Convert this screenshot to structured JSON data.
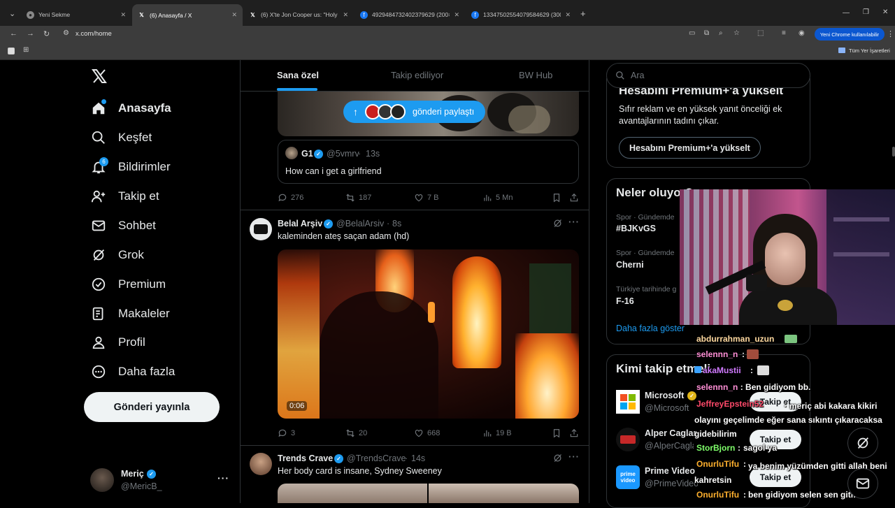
{
  "browser": {
    "tabs": [
      {
        "title": "Yeni Sekme"
      },
      {
        "title": "(6) Anasayfa / X"
      },
      {
        "title": "(6) X'te Jon Cooper us: \"Holy sh"
      },
      {
        "title": "492948473240237962​9 (200×2"
      },
      {
        "title": "133475025540795846​29 (300×"
      }
    ],
    "url": "x.com/home",
    "profile_button": "Yeni Chrome kullanılabilir",
    "bookmarks_all": "Tüm Yer İşaretleri"
  },
  "sidebar": {
    "items": [
      {
        "label": "Anasayfa",
        "icon": "home-icon"
      },
      {
        "label": "Keşfet",
        "icon": "search-icon"
      },
      {
        "label": "Bildirimler",
        "icon": "bell-icon",
        "badge": "6"
      },
      {
        "label": "Takip et",
        "icon": "person-add-icon"
      },
      {
        "label": "Sohbet",
        "icon": "mail-icon"
      },
      {
        "label": "Grok",
        "icon": "grok-icon"
      },
      {
        "label": "Premium",
        "icon": "verified-icon"
      },
      {
        "label": "Makaleler",
        "icon": "article-icon"
      },
      {
        "label": "Profil",
        "icon": "profile-icon"
      },
      {
        "label": "Daha fazla",
        "icon": "more-circle-icon"
      }
    ],
    "post_button": "Gönderi yayınla",
    "account": {
      "name": "Meriç",
      "handle": "@MericB_"
    }
  },
  "feed": {
    "tabs": [
      "Sana özel",
      "Takip ediliyor",
      "BW Hub"
    ],
    "share_pill": "gönderi paylaştı",
    "quoted": {
      "name": "G1",
      "handle": "@5vmrv",
      "time": "13s",
      "text": "How can i get a girlfriend"
    },
    "post0_metrics": {
      "replies": "276",
      "reposts": "187",
      "likes": "7 B",
      "views": "5 Mn"
    },
    "posts": [
      {
        "name": "Belal Arşiv",
        "handle": "@BelalArsiv",
        "time": "8s",
        "text": "kaleminden ateş saçan adam (hd)",
        "video_time": "0:06",
        "replies": "3",
        "reposts": "20",
        "likes": "668",
        "views": "19 B"
      },
      {
        "name": "Trends Crave",
        "handle": "@TrendsCrave",
        "time": "14s",
        "text": "Her body card is insane, Sydney Sweeney"
      }
    ]
  },
  "right": {
    "search_placeholder": "Ara",
    "premium": {
      "title": "Hesabını Premium+'a yükselt",
      "desc": "Sıfır reklam ve en yüksek yanıt önceliği ek avantajlarının tadını çıkar.",
      "button": "Hesabını Premium+'a yükselt"
    },
    "trends_title": "Neler oluyor?",
    "trends": [
      {
        "meta": "Spor · Gündemde",
        "name": "#BJKvGS"
      },
      {
        "meta": "Spor · Gündemde",
        "name": "Cherni"
      },
      {
        "meta": "Türkiye tarihinde g",
        "name": "F-16"
      }
    ],
    "show_more": "Daha fazla göster",
    "who_title": "Kimi takip etmeli",
    "who": [
      {
        "name": "Microsoft",
        "handle": "@Microsoft",
        "button": "Takip et"
      },
      {
        "name": "Alper Caglar",
        "handle": "@AlperCagla",
        "button": "Takip et"
      },
      {
        "name": "Prime Video",
        "handle": "@PrimeVideo",
        "button": "Takip et"
      }
    ]
  },
  "chat": [
    {
      "user": "abdurrahman_uzun",
      "msg": ""
    },
    {
      "user": "selennn_n",
      "msg": ""
    },
    {
      "user": "akaMustii",
      "msg": ""
    },
    {
      "user": "selennn_n",
      "msg": "Ben gidiyom bb."
    },
    {
      "user": "JeffreyEpstein52",
      "msg": "meriç abi kakara kikiri olayını geçelimde eğer sana sıkıntı çıkaracaksa gidebilirim"
    },
    {
      "user": "StorBjorn",
      "msg": "sagol ya"
    },
    {
      "user": "OnurluTifu",
      "msg": "ya benim yüzümden gitti allah beni kahretsin"
    },
    {
      "user": "OnurluTifu",
      "msg": "ben gidiyom selen sen gitme"
    }
  ],
  "colors": {
    "accent": "#1d9bf0",
    "bg": "#000000",
    "border": "#2f3336",
    "muted": "#71767b"
  }
}
